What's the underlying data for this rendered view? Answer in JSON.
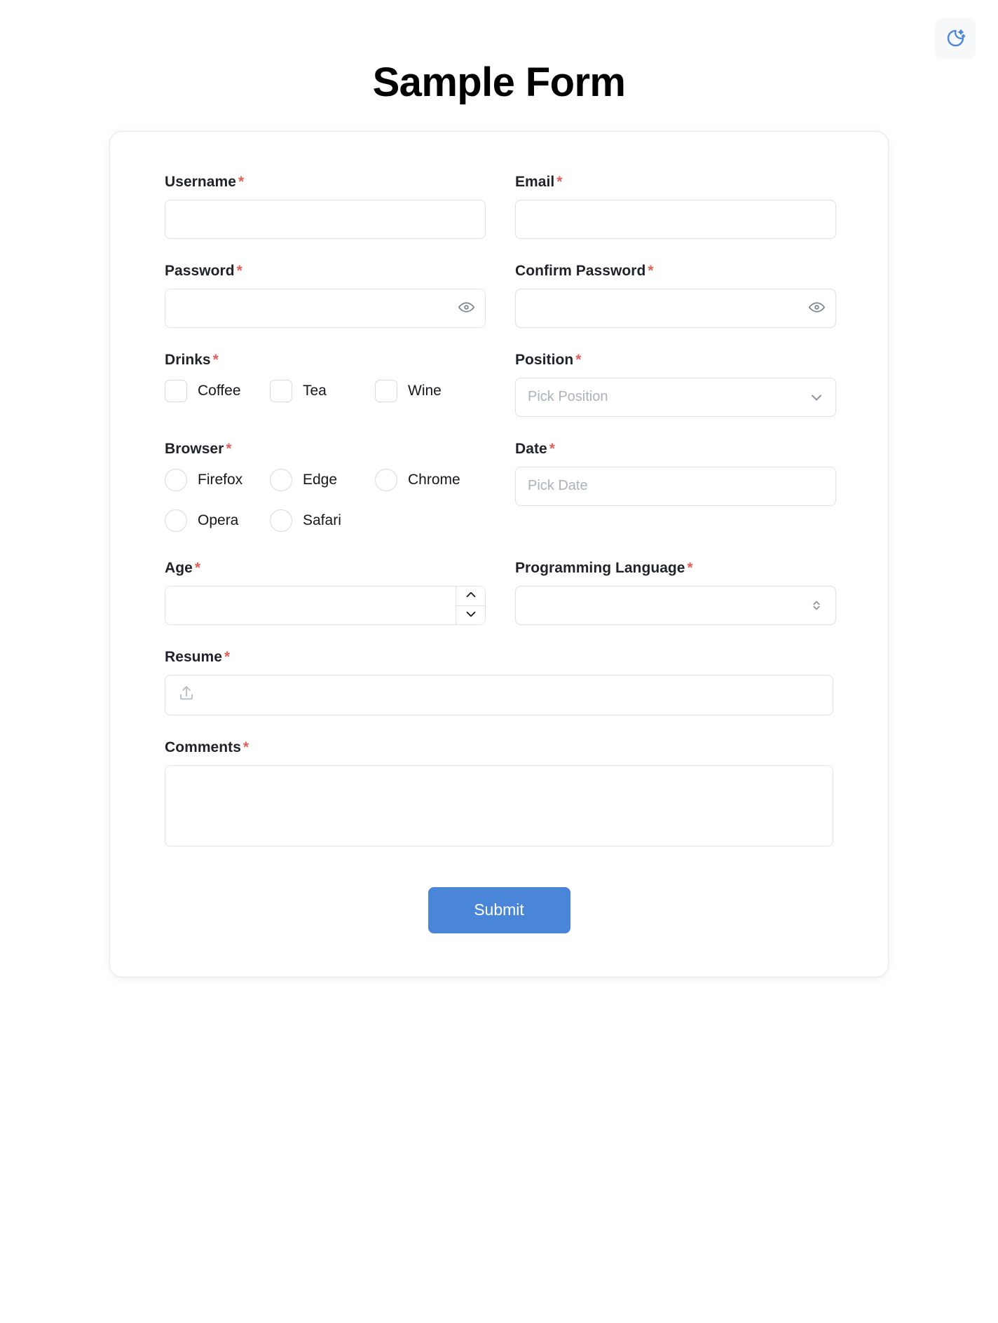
{
  "header": {
    "title": "Sample Form",
    "theme_toggle_icon": "moon-stars-icon"
  },
  "colors": {
    "accent": "#4a86d8",
    "required_asterisk": "#e4605a",
    "label": "#1f2329",
    "border": "#dde1e6",
    "placeholder": "#aab2bd",
    "card_background": "#ffffff",
    "page_background": "#ffffff"
  },
  "form": {
    "required_marker": "*",
    "fields": {
      "username": {
        "label": "Username",
        "value": "",
        "placeholder": ""
      },
      "email": {
        "label": "Email",
        "value": "",
        "placeholder": ""
      },
      "password": {
        "label": "Password",
        "value": "",
        "placeholder": "",
        "toggle_icon": "eye-icon"
      },
      "confirm_password": {
        "label": "Confirm Password",
        "value": "",
        "placeholder": "",
        "toggle_icon": "eye-icon"
      },
      "drinks": {
        "label": "Drinks",
        "options": [
          {
            "label": "Coffee",
            "checked": false
          },
          {
            "label": "Tea",
            "checked": false
          },
          {
            "label": "Wine",
            "checked": false
          }
        ]
      },
      "position": {
        "label": "Position",
        "value": "",
        "placeholder": "Pick Position",
        "icon": "chevron-down-icon"
      },
      "browser": {
        "label": "Browser",
        "options": [
          {
            "label": "Firefox",
            "selected": false
          },
          {
            "label": "Edge",
            "selected": false
          },
          {
            "label": "Chrome",
            "selected": false
          },
          {
            "label": "Opera",
            "selected": false
          },
          {
            "label": "Safari",
            "selected": false
          }
        ]
      },
      "date": {
        "label": "Date",
        "value": "",
        "placeholder": "Pick Date"
      },
      "age": {
        "label": "Age",
        "value": "",
        "placeholder": "",
        "increment_icon": "chevron-up-icon",
        "decrement_icon": "chevron-down-icon"
      },
      "programming_language": {
        "label": "Programming Language",
        "value": "",
        "placeholder": "",
        "icon": "chevron-up-down-icon"
      },
      "resume": {
        "label": "Resume",
        "value": "",
        "icon": "upload-icon"
      },
      "comments": {
        "label": "Comments",
        "value": "",
        "placeholder": ""
      }
    },
    "submit_label": "Submit"
  }
}
